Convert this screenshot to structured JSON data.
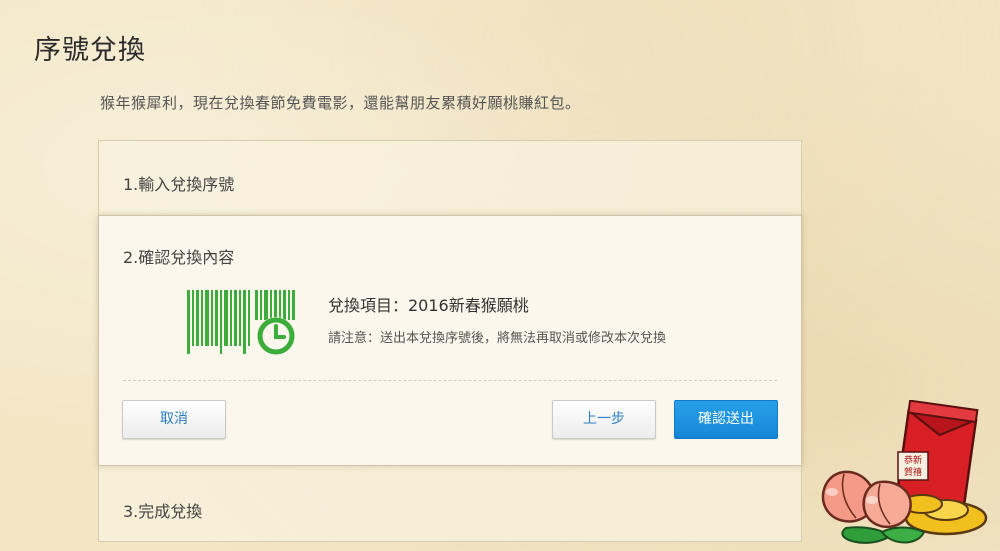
{
  "page": {
    "title": "序號兌換",
    "intro": "猴年猴犀利，現在兌換春節免費電影，還能幫朋友累積好願桃賺紅包。"
  },
  "steps": {
    "step1": {
      "label": "1.輸入兌換序號"
    },
    "step2": {
      "label": "2.確認兌換內容",
      "item_title": "兌換項目：2016新春猴願桃",
      "notice": "請注意：送出本兌換序號後，將無法再取消或修改本次兌換",
      "buttons": {
        "cancel": "取消",
        "prev": "上一步",
        "submit": "確認送出"
      }
    },
    "step3": {
      "label": "3.完成兌換"
    }
  },
  "decoration": {
    "envelope_text": "恭新賀禧"
  },
  "colors": {
    "accent_green": "#3aad3a",
    "primary_blue": "#1a8ee0",
    "link_blue": "#2a7fc8",
    "envelope_red": "#d81f26"
  },
  "icons": {
    "barcode": "barcode-icon",
    "clock": "clock-icon"
  }
}
